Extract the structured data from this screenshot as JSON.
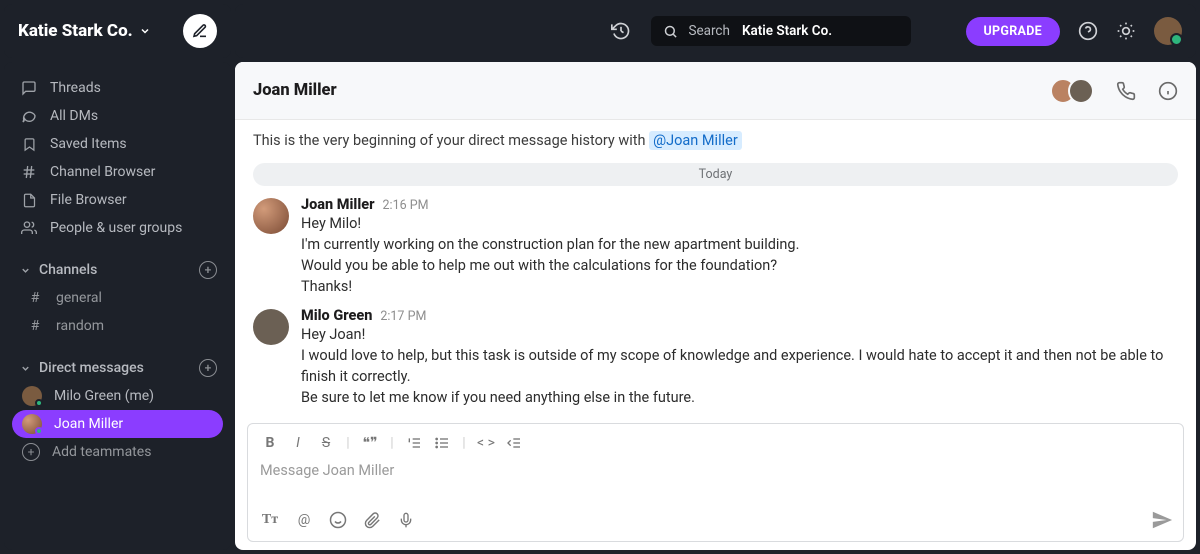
{
  "workspace": {
    "name": "Katie Stark Co."
  },
  "nav": {
    "threads": "Threads",
    "alldms": "All DMs",
    "saved": "Saved Items",
    "channel_browser": "Channel Browser",
    "file_browser": "File Browser",
    "people": "People & user groups"
  },
  "sections": {
    "channels_label": "Channels",
    "dms_label": "Direct messages",
    "add_teammates": "Add teammates"
  },
  "channels": [
    {
      "name": "general"
    },
    {
      "name": "random"
    }
  ],
  "dms": [
    {
      "name": "Milo Green (me)"
    },
    {
      "name": "Joan Miller"
    }
  ],
  "search": {
    "prefix": "Search",
    "term": "Katie Stark Co."
  },
  "topbar": {
    "upgrade": "UPGRADE"
  },
  "chat": {
    "title": "Joan Miller",
    "intro_prefix": "This is the very beginning of your direct message history with ",
    "intro_mention": "@Joan Miller",
    "divider": "Today"
  },
  "messages": [
    {
      "author": "Joan Miller",
      "time": "2:16 PM",
      "lines": [
        "Hey Milo!",
        "I'm currently working on the construction plan for the new apartment building.",
        "Would you be able to help me out with the calculations for the foundation?",
        "Thanks!"
      ]
    },
    {
      "author": "Milo Green",
      "time": "2:17 PM",
      "lines": [
        "Hey Joan!",
        "I would love to help, but this task is outside of my scope of knowledge and experience. I would hate to accept it and then not be able to finish it correctly.",
        "Be sure to let me know if you need anything else in the future."
      ]
    }
  ],
  "composer": {
    "placeholder": "Message Joan Miller"
  }
}
